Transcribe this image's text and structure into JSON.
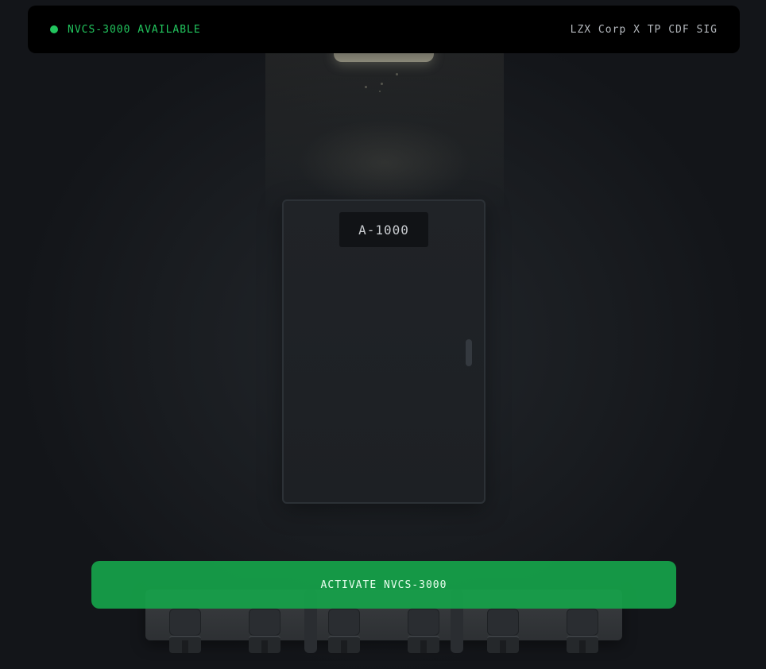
{
  "topbar": {
    "status_text": "NVCS-3000 AVAILABLE",
    "status_color": "#22c55e",
    "brand_text": "LZX Corp X TP CDF SIG"
  },
  "door": {
    "plate_label": "A-1000"
  },
  "action": {
    "activate_label": "ACTIVATE NVCS-3000",
    "button_color": "#16a34a"
  },
  "icons": {
    "status_indicator": "status-dot-icon",
    "lamp": "ceiling-lamp-icon",
    "door_handle": "door-handle-icon"
  }
}
